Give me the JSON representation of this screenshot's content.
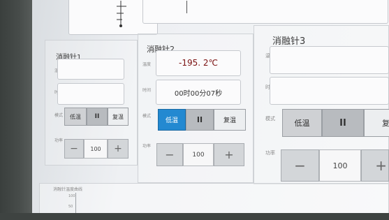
{
  "needles": [
    {
      "title": "消融针1",
      "temp_label": "温度",
      "temp_value": "",
      "time_label": "时间",
      "time_value": "",
      "mode_label": "模式",
      "mode_buttons": [
        "低温",
        "II",
        "复温"
      ],
      "power_label": "功率",
      "stepper": {
        "minus": "−",
        "value": "100",
        "plus": "+"
      }
    },
    {
      "title": "消融针2",
      "temp_label": "温度",
      "temp_value": "-195. 2℃",
      "time_label": "时间",
      "time_value": "00时00分07秒",
      "mode_label": "模式",
      "mode_buttons": [
        "低温",
        "II",
        "复温"
      ],
      "active_mode": "低温",
      "power_label": "功率",
      "stepper": {
        "minus": "−",
        "value": "100",
        "plus": "+"
      }
    },
    {
      "title": "消融针3",
      "temp_label": "温度",
      "temp_value": "",
      "time_label": "时间",
      "time_value": "",
      "mode_label": "模式",
      "mode_buttons": [
        "低温",
        "II",
        "复"
      ],
      "power_label": "功率",
      "stepper": {
        "minus": "−",
        "value": "100",
        "plus": "+"
      }
    }
  ],
  "chart": {
    "title": "消融针温度曲线",
    "yticks": [
      "100",
      "50"
    ]
  },
  "colors": {
    "active_mode": "#2389d1",
    "temperature_text": "#7a1010",
    "screen_bg": "#f2f3f5"
  }
}
